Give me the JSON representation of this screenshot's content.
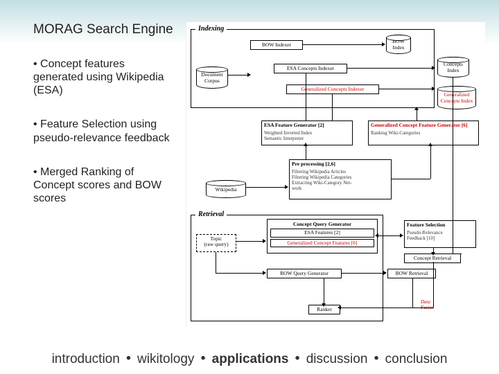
{
  "left": {
    "title": "MORAG Search Engine",
    "bullets": [
      "Concept features generated using Wikipedia (ESA)",
      "Feature Selection using pseudo-relevance feedback",
      "Merged Ranking of Concept scores and BOW scores"
    ]
  },
  "sections": {
    "indexing": "Indexing",
    "retrieval": "Retrieval"
  },
  "boxes": {
    "doc_corpus": "Document\nCorpus",
    "bow_indexer": "BOW Indexer",
    "bow_index": "BOW\nIndex",
    "esa_concepts_indexer": "ESA Concepts Indexer",
    "concepts_index": "Concepts\nIndex",
    "gen_concepts_indexer": "Generalized Concepts Indexer",
    "gen_concepts_index": "Generalized\nConcepts Index",
    "esa_feature_gen": "ESA Feature Generator [2]",
    "esa_feature_gen_sub": "Weighted Inverted Index\nSemantic Interpreter",
    "gen_concept_feat_gen": "Generalized Concept Feature Generator [6]",
    "gen_concept_feat_gen_sub": "Ranking Wiki-Categories",
    "wikipedia": "Wikipedia",
    "preprocessing": "Pre processing [2,6]",
    "preprocessing_sub": "Filtering Wikipedia Articles\nFiltering Wikipedia Categories\nExtracting Wiki-Category Net-\nwork",
    "topic": "Topic\n(raw query)",
    "concept_query_gen": "Concept Query Generator",
    "esa_features": "ESA Features [2]",
    "gen_concept_features": "Generalized Concept Features [6]",
    "feature_selection": "Feature Selection",
    "feature_selection_sub": "Pseudo-Relevance\nFeedback [10]",
    "bow_query_gen": "BOW Query Generator",
    "bow_retrieval": "BOW Retrieval",
    "concept_retrieval": "Concept Retrieval",
    "ranker": "Ranker",
    "data_fusion": "Data\nFusion"
  },
  "footer": {
    "items": [
      "introduction",
      "wikitology",
      "applications",
      "discussion",
      "conclusion"
    ],
    "emphasis_index": 2,
    "sep": "•"
  }
}
